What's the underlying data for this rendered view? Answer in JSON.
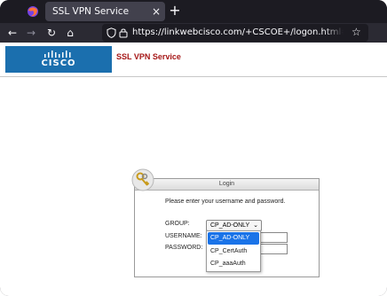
{
  "browser": {
    "tab": {
      "title": "SSL VPN Service",
      "close": "×"
    },
    "new_tab": "+",
    "nav": {
      "back": "←",
      "forward": "→",
      "reload": "↻",
      "home": "⌂"
    },
    "url": "https://linkwebcisco.com/+CSCOE+/logon.html#form_title_te",
    "star": "☆",
    "accent": "#42414d"
  },
  "header": {
    "logo_text": "CISCO",
    "title": "SSL VPN Service",
    "title_color": "#a61818",
    "logo_color": "#1b6fae"
  },
  "login": {
    "title": "Login",
    "instructions": "Please enter your username and password.",
    "group_label": "GROUP:",
    "group_selected": "CP_AD-ONLY",
    "username_label": "USERNAME:",
    "password_label": "PASSWORD:",
    "group_options": [
      "CP_AD-ONLY",
      "CP_CertAuth",
      "CP_aaaAuth"
    ],
    "highlight_color": "#1a73e8"
  }
}
